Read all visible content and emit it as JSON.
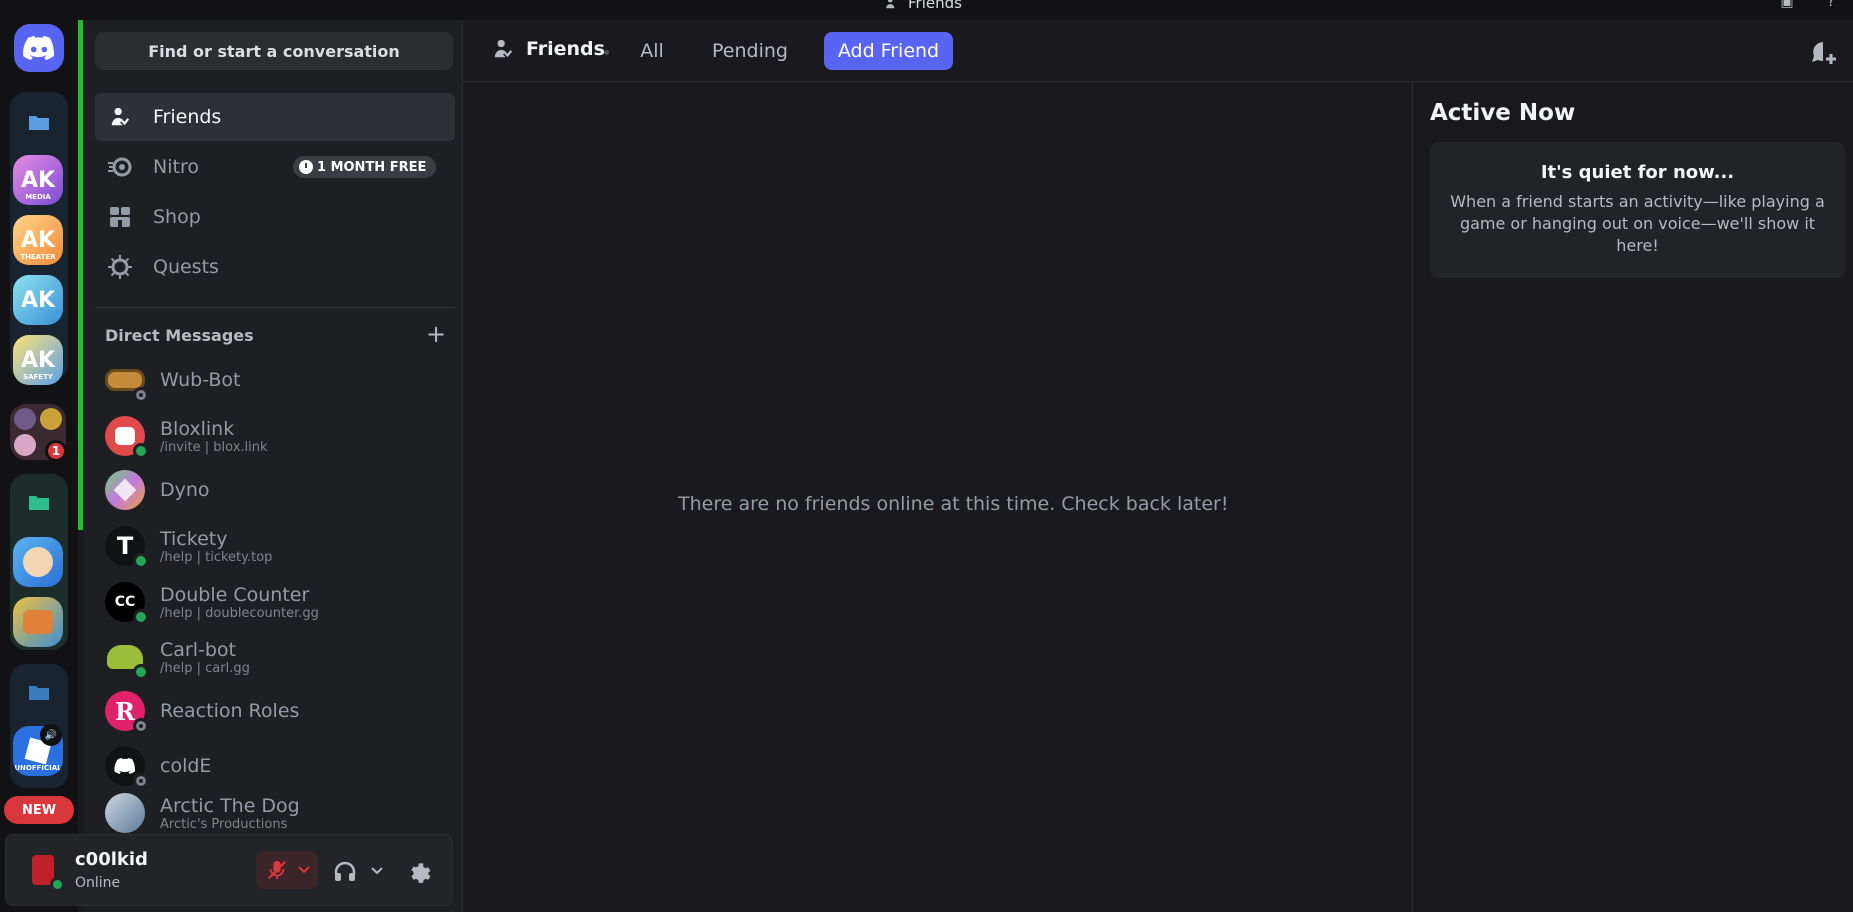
{
  "window": {
    "title": "Friends"
  },
  "search": {
    "placeholder": "Find or start a conversation"
  },
  "nav": [
    {
      "label": "Friends",
      "icon": "friends-icon"
    },
    {
      "label": "Nitro",
      "icon": "nitro-icon",
      "pill": "1 MONTH FREE"
    },
    {
      "label": "Shop",
      "icon": "shop-icon"
    },
    {
      "label": "Quests",
      "icon": "quests-icon"
    }
  ],
  "servers": {
    "server1": {
      "text": "AK",
      "sub": "MEDIA"
    },
    "server2": {
      "text": "AK",
      "sub": "THEATER"
    },
    "server3": {
      "text": "AK",
      "sub": ""
    },
    "server4": {
      "text": "AK",
      "sub": "SAFETY"
    },
    "group_badge": "1",
    "server_unofficial_sub": "UNOFFICIAL",
    "new_label": "NEW"
  },
  "dm_header": "Direct Messages",
  "dms": [
    {
      "name": "Wub-Bot",
      "sub": "",
      "status": "offline"
    },
    {
      "name": "Bloxlink",
      "sub": "/invite | blox.link",
      "status": "online"
    },
    {
      "name": "Dyno",
      "sub": "",
      "status": "none"
    },
    {
      "name": "Tickety",
      "sub": "/help | tickety.top",
      "status": "online"
    },
    {
      "name": "Double Counter",
      "sub": "/help | doublecounter.gg",
      "status": "online"
    },
    {
      "name": "Carl-bot",
      "sub": "/help | carl.gg",
      "status": "online"
    },
    {
      "name": "Reaction Roles",
      "sub": "",
      "status": "offline"
    },
    {
      "name": "coldE",
      "sub": "",
      "status": "offline"
    },
    {
      "name": "Arctic The Dog",
      "sub": "Arctic's Productions",
      "status": "idle"
    }
  ],
  "user": {
    "name": "c00lkid",
    "status": "Online"
  },
  "topbar": {
    "title": "Friends",
    "tabs": [
      "All",
      "Pending"
    ],
    "add_friend": "Add Friend"
  },
  "main": {
    "empty_message": "There are no friends online at this time. Check back later!"
  },
  "active_now": {
    "title": "Active Now",
    "card_title": "It's quiet for now...",
    "card_desc": "When a friend starts an activity—like playing a game or hanging out on voice—we'll show it here!"
  },
  "colors": {
    "accent": "#5865f2",
    "online": "#23a55a",
    "danger": "#da373c",
    "active_bar": "#1fbf2e"
  }
}
